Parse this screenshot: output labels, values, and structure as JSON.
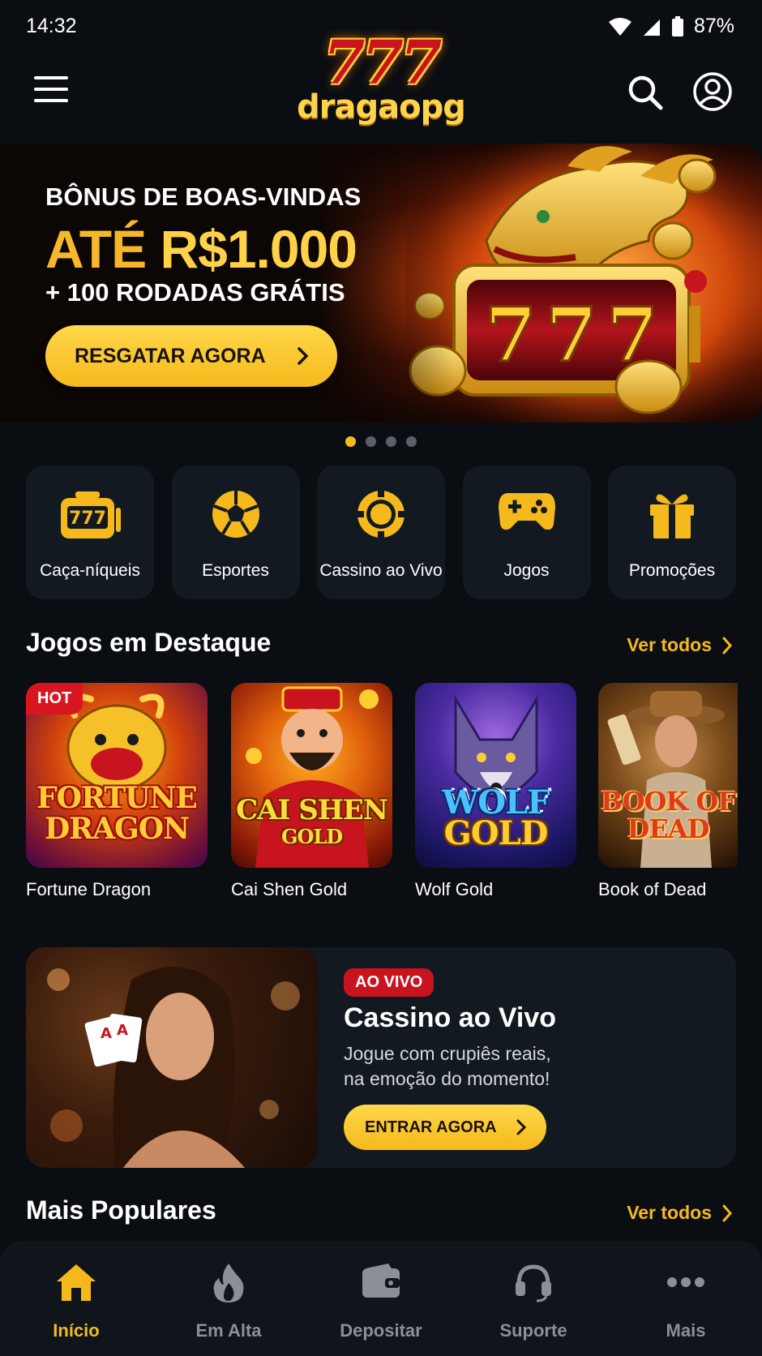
{
  "status_bar": {
    "time": "14:32",
    "battery": "87%"
  },
  "header": {
    "logo_number": "777",
    "logo_word": "dragaopg"
  },
  "banner": {
    "kicker": "BÔNUS DE BOAS-VINDAS",
    "amount_prefix": "ATÉ",
    "amount_value": "R$1.000",
    "spins": "+ 100 RODADAS GRÁTIS",
    "cta": "RESGATAR AGORA",
    "art_number": "777",
    "slides": 4,
    "active_slide": 1
  },
  "categories": [
    {
      "label": "Caça-níqueis",
      "icon": "slot-machine-icon"
    },
    {
      "label": "Esportes",
      "icon": "soccer-ball-icon"
    },
    {
      "label": "Cassino ao Vivo",
      "icon": "casino-chip-icon"
    },
    {
      "label": "Jogos",
      "icon": "gamepad-icon"
    },
    {
      "label": "Promoções",
      "icon": "gift-icon"
    }
  ],
  "featured": {
    "title": "Jogos em Destaque",
    "see_all": "Ver todos",
    "games": [
      {
        "name": "Fortune Dragon",
        "art_line1": "FORTUNE",
        "art_line2": "DRAGON",
        "badge": "HOT"
      },
      {
        "name": "Cai Shen Gold",
        "art_line1": "CAI SHEN",
        "art_line2": "GOLD"
      },
      {
        "name": "Wolf Gold",
        "art_line1": "WOLF",
        "art_line2": "GOLD"
      },
      {
        "name": "Book of Dead",
        "art_line1": "BOOK OF",
        "art_line2": "DEAD"
      }
    ]
  },
  "live": {
    "badge": "AO VIVO",
    "title": "Cassino ao Vivo",
    "desc_line1": "Jogue com crupiês reais,",
    "desc_line2": "na emoção do momento!",
    "cta": "ENTRAR AGORA"
  },
  "popular": {
    "title": "Mais Populares",
    "see_all": "Ver todos"
  },
  "bottom_nav": [
    {
      "label": "Início",
      "icon": "home-icon",
      "active": true
    },
    {
      "label": "Em Alta",
      "icon": "fire-icon",
      "active": false
    },
    {
      "label": "Depositar",
      "icon": "wallet-icon",
      "active": false
    },
    {
      "label": "Suporte",
      "icon": "headset-icon",
      "active": false
    },
    {
      "label": "Mais",
      "icon": "more-dots-icon",
      "active": false
    }
  ],
  "colors": {
    "accent": "#f5b91c",
    "background": "#0a0d12",
    "card": "#131920",
    "live_red": "#c8141e"
  }
}
